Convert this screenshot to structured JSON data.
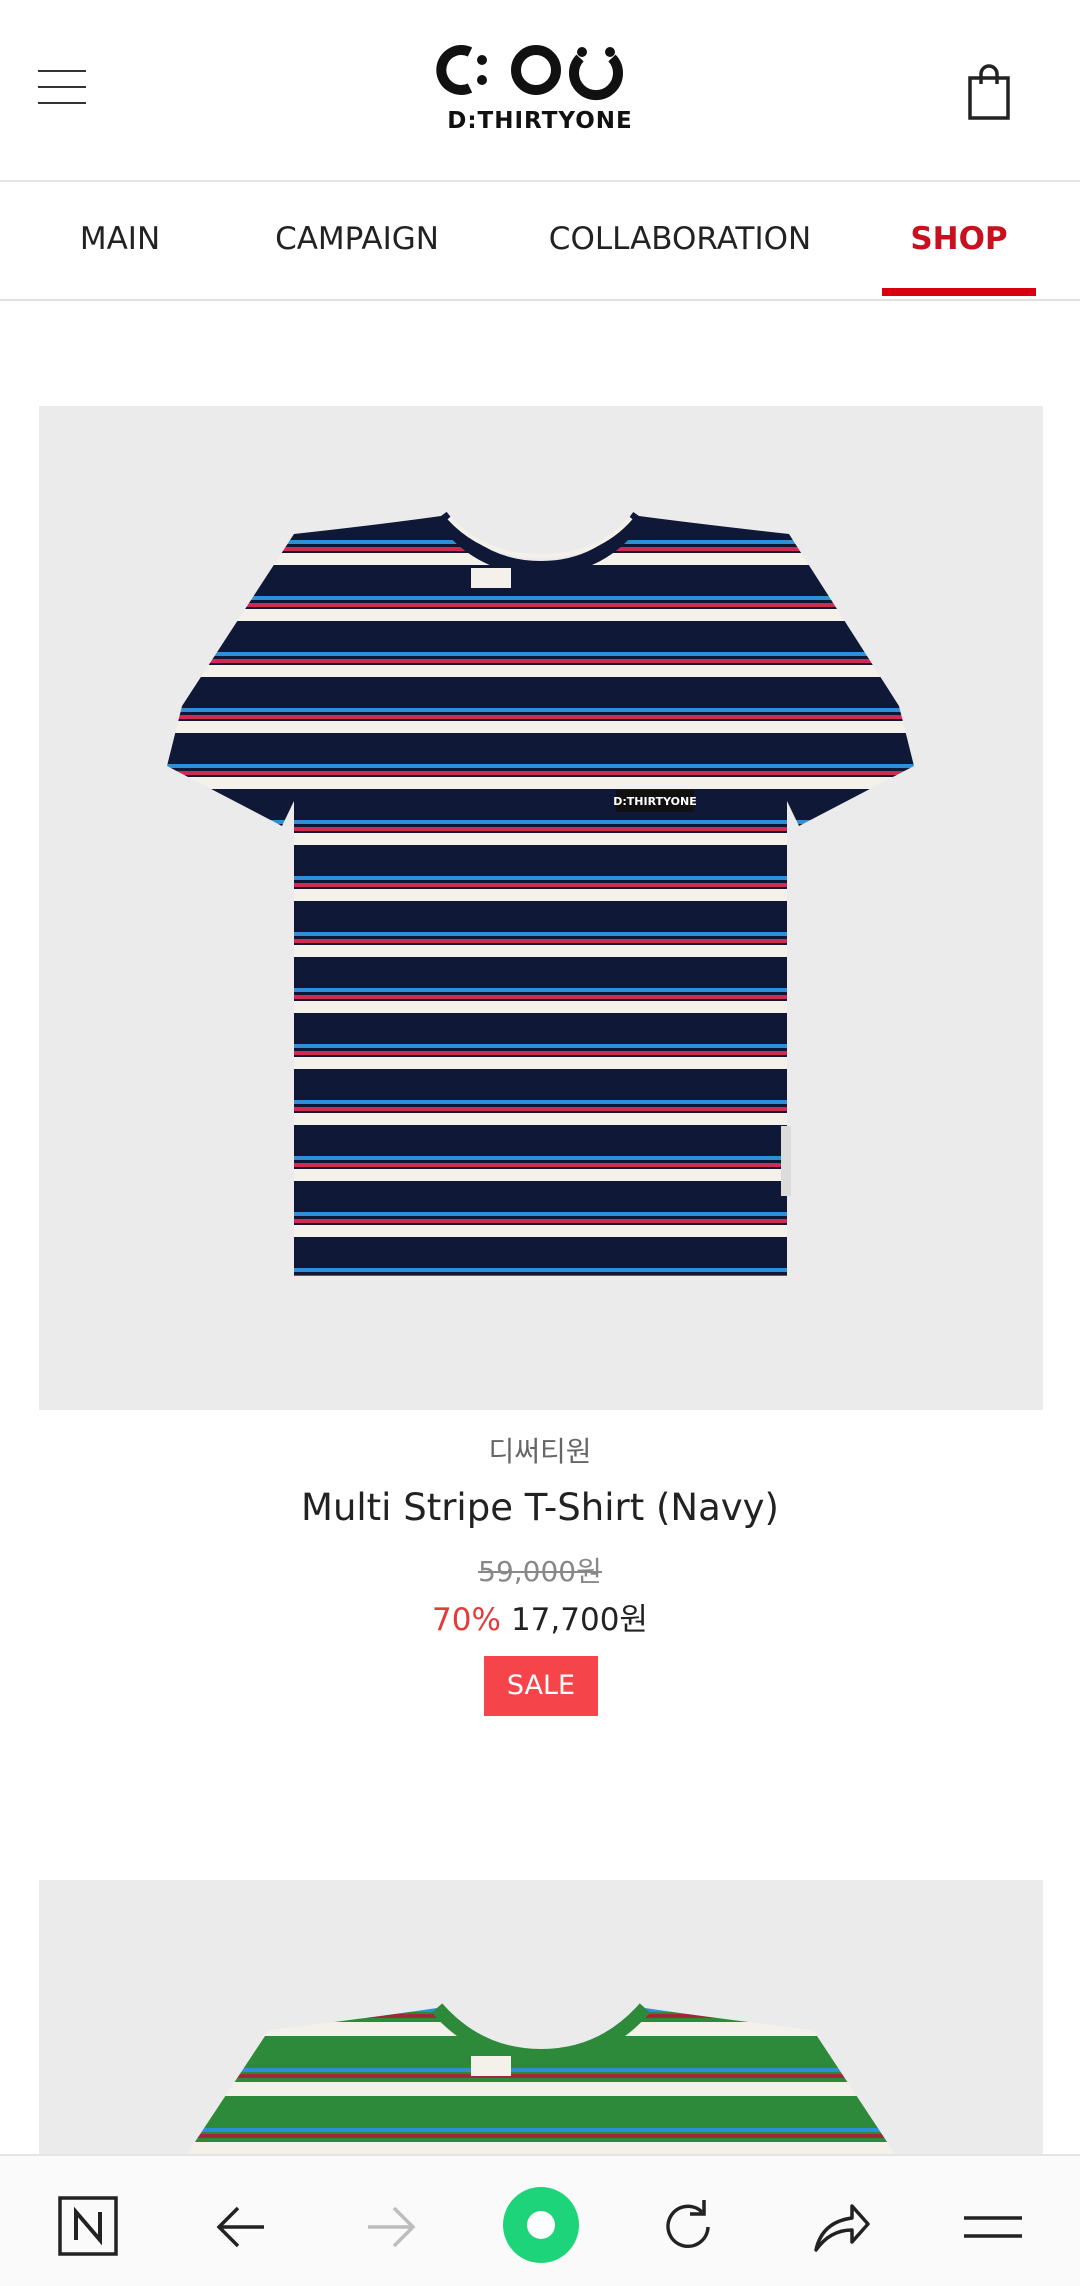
{
  "header": {
    "logo_text": "D:THIRTYONE",
    "menu_icon": "hamburger-menu-icon",
    "bag_icon": "shopping-bag-icon"
  },
  "tabs": [
    {
      "label": "MAIN",
      "active": false
    },
    {
      "label": "CAMPAIGN",
      "active": false
    },
    {
      "label": "COLLABORATION",
      "active": false
    },
    {
      "label": "SHOP",
      "active": true
    }
  ],
  "products": [
    {
      "brand": "디써티원",
      "name": "Multi Stripe T-Shirt (Navy)",
      "original_price": "59,000원",
      "discount": "70%",
      "price": "17,700원",
      "badge": "SALE",
      "label_text": "D:THIRTYONE"
    }
  ],
  "bottom_nav": {
    "icons": [
      "naver-n-icon",
      "back-arrow-icon",
      "forward-arrow-icon",
      "home-circle-icon",
      "reload-icon",
      "share-icon",
      "menu-icon"
    ]
  },
  "colors": {
    "accent_red": "#d8000f",
    "sale_badge": "#f5454a",
    "discount_text": "#e33a3a",
    "home_green": "#1ed47b"
  }
}
